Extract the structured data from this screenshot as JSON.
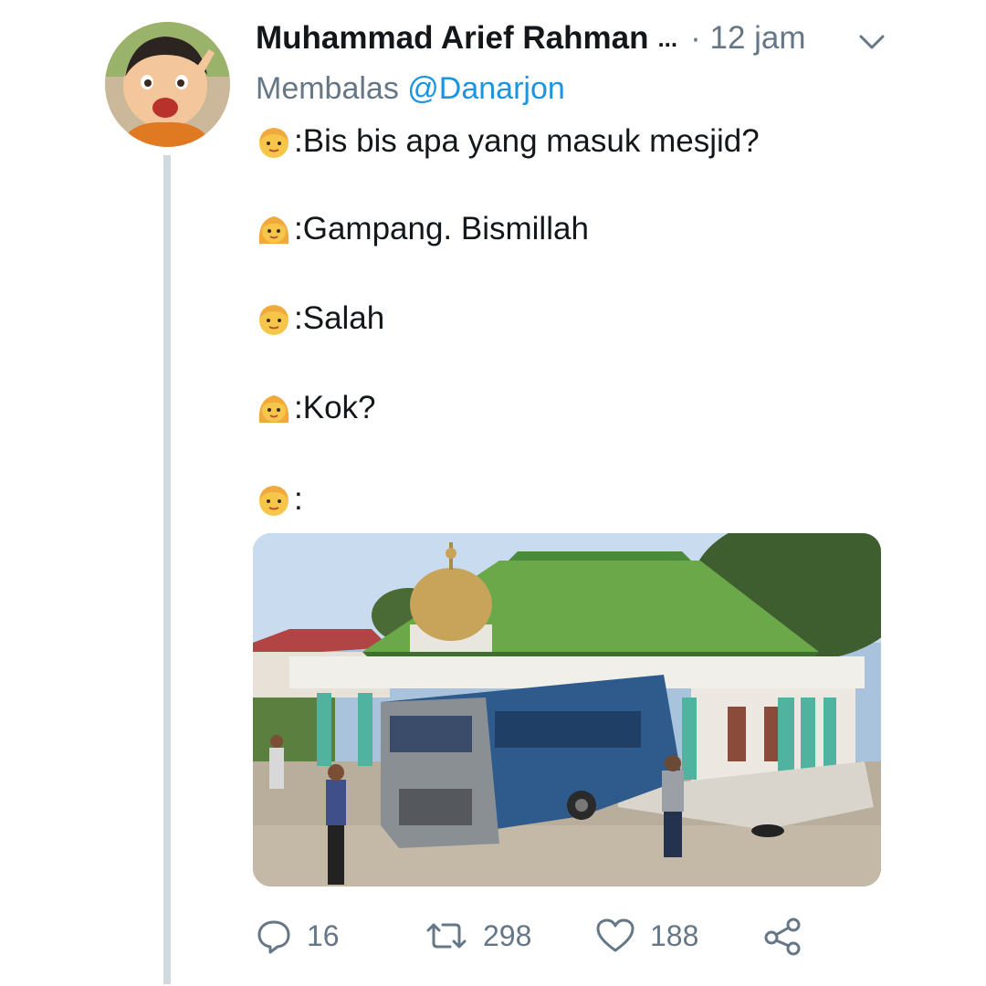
{
  "tweet": {
    "author_name": "Muhammad Arief Rahman",
    "author_ellipsis": "...",
    "time": "· 12 jam",
    "reply_prefix": "Membalas",
    "reply_handle": "@Danarjon",
    "lines": [
      {
        "speaker": "boy-emoji",
        "text": ":Bis bis apa yang masuk mesjid?"
      },
      {
        "speaker": "girl-emoji",
        "text": ":Gampang. Bismillah"
      },
      {
        "speaker": "boy-emoji",
        "text": ":Salah"
      },
      {
        "speaker": "girl-emoji",
        "text": ":Kok?"
      },
      {
        "speaker": "boy-emoji",
        "text": ":"
      }
    ],
    "media": {
      "description_icon": "photo-bus-crashed-into-mosque"
    },
    "actions": {
      "replies": "16",
      "retweets": "298",
      "likes": "188"
    }
  },
  "icons": {
    "reply": "speech-bubble-icon",
    "retweet": "retweet-icon",
    "like": "heart-icon",
    "share": "share-icon",
    "menu": "chevron-down-icon"
  },
  "colors": {
    "text": "#14171a",
    "secondary": "#657786",
    "link": "#1b95e0",
    "thread_line": "#cfd9de"
  }
}
